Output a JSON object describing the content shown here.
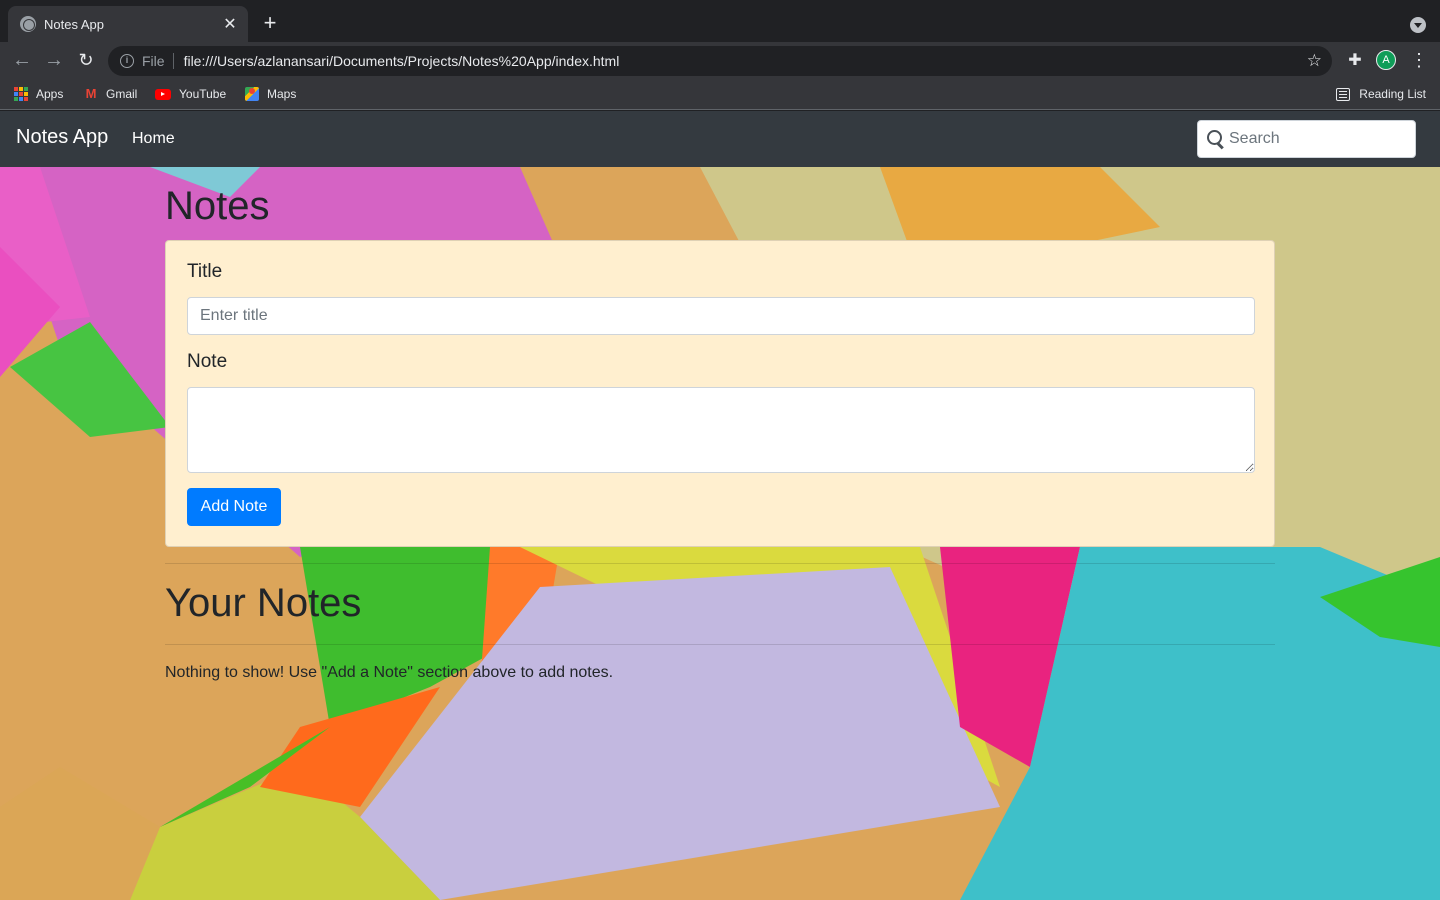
{
  "browser": {
    "tab_title": "Notes App",
    "tab_close": "✕",
    "new_tab": "+",
    "scheme_label": "File",
    "url": "file:///Users/azlanansari/Documents/Projects/Notes%20App/index.html",
    "avatar_letter": "A",
    "bookmarks": [
      {
        "label": "Apps",
        "icon": "apps-icon"
      },
      {
        "label": "Gmail",
        "icon": "gmail-icon"
      },
      {
        "label": "YouTube",
        "icon": "youtube-icon"
      },
      {
        "label": "Maps",
        "icon": "maps-icon"
      }
    ],
    "reading_list": "Reading List"
  },
  "navbar": {
    "brand": "Notes App",
    "home": "Home",
    "search_placeholder": "Search"
  },
  "main": {
    "heading": "Notes",
    "form": {
      "title_label": "Title",
      "title_placeholder": "Enter title",
      "title_value": "",
      "note_label": "Note",
      "note_value": "",
      "add_button": "Add Note"
    },
    "your_notes_heading": "Your Notes",
    "empty_message": "Nothing to show! Use \"Add a Note\" section above to add notes."
  },
  "colors": {
    "navbar_bg": "#343a40",
    "card_bg": "#ffefcf",
    "primary": "#007bff"
  }
}
